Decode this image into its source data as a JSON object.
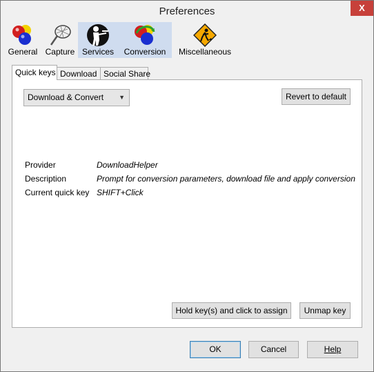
{
  "window": {
    "title": "Preferences",
    "close_glyph": "X"
  },
  "toolbar": {
    "items": [
      {
        "label": "General",
        "icon": "color-balls-icon",
        "selected": false
      },
      {
        "label": "Capture",
        "icon": "net-icon",
        "selected": false
      },
      {
        "label": "Services",
        "icon": "butler-icon",
        "selected": true
      },
      {
        "label": "Conversion",
        "icon": "conversion-balls-icon",
        "selected": true
      },
      {
        "label": "Miscellaneous",
        "icon": "construction-sign-icon",
        "selected": false
      }
    ]
  },
  "tabs": [
    {
      "label": "Quick keys",
      "active": true
    },
    {
      "label": "Download",
      "active": false
    },
    {
      "label": "Social Share",
      "active": false
    }
  ],
  "panel": {
    "select_value": "Download & Convert",
    "revert_label": "Revert to default",
    "info": {
      "provider_label": "Provider",
      "provider_value": "DownloadHelper",
      "description_label": "Description",
      "description_value": "Prompt for conversion parameters, download file and apply conversion",
      "quickkey_label": "Current quick key",
      "quickkey_value": "SHIFT+Click"
    },
    "assign_label": "Hold key(s) and click to assign",
    "unmap_label": "Unmap key"
  },
  "footer": {
    "ok_label": "OK",
    "cancel_label": "Cancel",
    "help_label": "Help"
  }
}
